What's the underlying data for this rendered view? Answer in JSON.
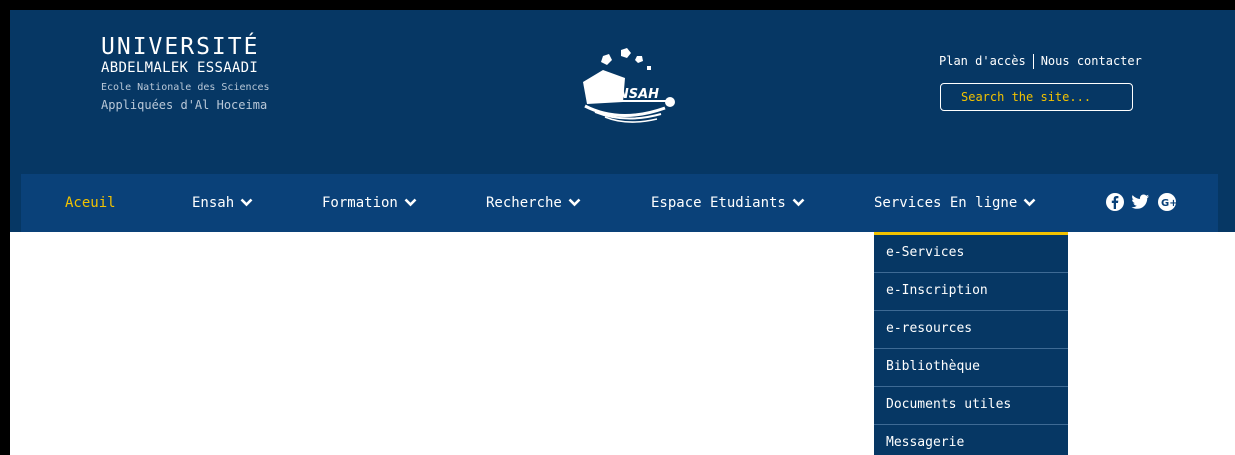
{
  "brand": {
    "title": "UNIVERSITÉ",
    "subtitle": "ABDELMALEK ESSAADI",
    "school_line1": "Ecole Nationale des Sciences",
    "school_line2": "Appliquées d'Al Hoceima",
    "logo_text": "ENSAH"
  },
  "top_links": {
    "access_map": "Plan d'accès",
    "contact": "Nous contacter"
  },
  "search": {
    "placeholder": "Search the site..."
  },
  "nav": {
    "home": "Aceuil",
    "ensah": "Ensah",
    "formation": "Formation",
    "recherche": "Recherche",
    "espace_etudiants": "Espace Etudiants",
    "services": "Services En ligne"
  },
  "social_icons": [
    "facebook-icon",
    "twitter-icon",
    "google-plus-icon"
  ],
  "dropdown": {
    "items": [
      {
        "label": "e-Services"
      },
      {
        "label": "e-Inscription"
      },
      {
        "label": "e-resources"
      },
      {
        "label": "Bibliothèque"
      },
      {
        "label": "Documents utiles"
      },
      {
        "label": "Messagerie"
      }
    ]
  },
  "colors": {
    "header_bg": "#063764",
    "nav_bg": "#0a4179",
    "accent": "#f2c200",
    "text": "#ffffff"
  }
}
